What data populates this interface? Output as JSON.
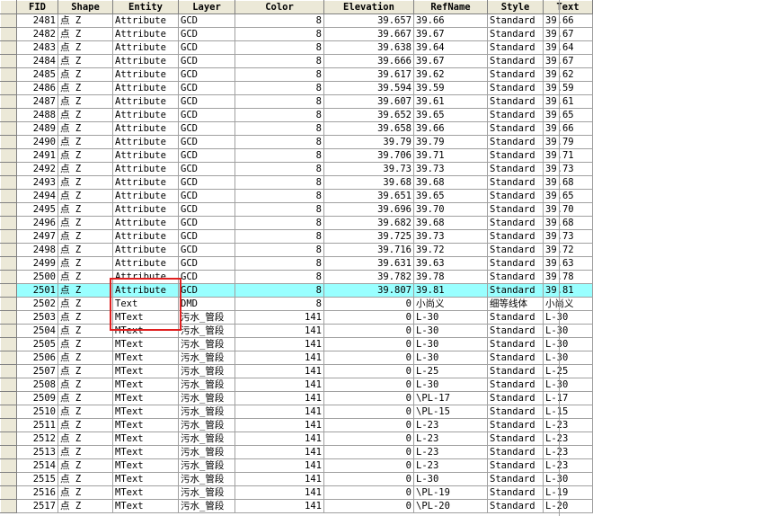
{
  "table": {
    "columns": [
      "FID",
      "Shape",
      "Entity",
      "Layer",
      "Color",
      "Elevation",
      "RefName",
      "Style",
      "Text"
    ],
    "highlighted_fid": "2501",
    "rows": [
      [
        "2481",
        "点 Z",
        "Attribute",
        "GCD",
        "8",
        "39.657",
        "39.66",
        "Standard",
        "39.66"
      ],
      [
        "2482",
        "点 Z",
        "Attribute",
        "GCD",
        "8",
        "39.667",
        "39.67",
        "Standard",
        "39.67"
      ],
      [
        "2483",
        "点 Z",
        "Attribute",
        "GCD",
        "8",
        "39.638",
        "39.64",
        "Standard",
        "39.64"
      ],
      [
        "2484",
        "点 Z",
        "Attribute",
        "GCD",
        "8",
        "39.666",
        "39.67",
        "Standard",
        "39.67"
      ],
      [
        "2485",
        "点 Z",
        "Attribute",
        "GCD",
        "8",
        "39.617",
        "39.62",
        "Standard",
        "39.62"
      ],
      [
        "2486",
        "点 Z",
        "Attribute",
        "GCD",
        "8",
        "39.594",
        "39.59",
        "Standard",
        "39.59"
      ],
      [
        "2487",
        "点 Z",
        "Attribute",
        "GCD",
        "8",
        "39.607",
        "39.61",
        "Standard",
        "39.61"
      ],
      [
        "2488",
        "点 Z",
        "Attribute",
        "GCD",
        "8",
        "39.652",
        "39.65",
        "Standard",
        "39.65"
      ],
      [
        "2489",
        "点 Z",
        "Attribute",
        "GCD",
        "8",
        "39.658",
        "39.66",
        "Standard",
        "39.66"
      ],
      [
        "2490",
        "点 Z",
        "Attribute",
        "GCD",
        "8",
        "39.79",
        "39.79",
        "Standard",
        "39.79"
      ],
      [
        "2491",
        "点 Z",
        "Attribute",
        "GCD",
        "8",
        "39.706",
        "39.71",
        "Standard",
        "39.71"
      ],
      [
        "2492",
        "点 Z",
        "Attribute",
        "GCD",
        "8",
        "39.73",
        "39.73",
        "Standard",
        "39.73"
      ],
      [
        "2493",
        "点 Z",
        "Attribute",
        "GCD",
        "8",
        "39.68",
        "39.68",
        "Standard",
        "39.68"
      ],
      [
        "2494",
        "点 Z",
        "Attribute",
        "GCD",
        "8",
        "39.651",
        "39.65",
        "Standard",
        "39.65"
      ],
      [
        "2495",
        "点 Z",
        "Attribute",
        "GCD",
        "8",
        "39.696",
        "39.70",
        "Standard",
        "39.70"
      ],
      [
        "2496",
        "点 Z",
        "Attribute",
        "GCD",
        "8",
        "39.682",
        "39.68",
        "Standard",
        "39.68"
      ],
      [
        "2497",
        "点 Z",
        "Attribute",
        "GCD",
        "8",
        "39.725",
        "39.73",
        "Standard",
        "39.73"
      ],
      [
        "2498",
        "点 Z",
        "Attribute",
        "GCD",
        "8",
        "39.716",
        "39.72",
        "Standard",
        "39.72"
      ],
      [
        "2499",
        "点 Z",
        "Attribute",
        "GCD",
        "8",
        "39.631",
        "39.63",
        "Standard",
        "39.63"
      ],
      [
        "2500",
        "点 Z",
        "Attribute",
        "GCD",
        "8",
        "39.782",
        "39.78",
        "Standard",
        "39.78"
      ],
      [
        "2501",
        "点 Z",
        "Attribute",
        "GCD",
        "8",
        "39.807",
        "39.81",
        "Standard",
        "39.81"
      ],
      [
        "2502",
        "点 Z",
        "Text",
        "DMD",
        "8",
        "0",
        "小尚义",
        "细等线体",
        "小尚义"
      ],
      [
        "2503",
        "点 Z",
        "MText",
        "污水_管段",
        "141",
        "0",
        " L-30",
        "Standard",
        " L-30"
      ],
      [
        "2504",
        "点 Z",
        "MText",
        "污水_管段",
        "141",
        "0",
        " L-30",
        "Standard",
        " L-30"
      ],
      [
        "2505",
        "点 Z",
        "MText",
        "污水_管段",
        "141",
        "0",
        " L-30",
        "Standard",
        " L-30"
      ],
      [
        "2506",
        "点 Z",
        "MText",
        "污水_管段",
        "141",
        "0",
        " L-30",
        "Standard",
        " L-30"
      ],
      [
        "2507",
        "点 Z",
        "MText",
        "污水_管段",
        "141",
        "0",
        " L-25",
        "Standard",
        " L-25"
      ],
      [
        "2508",
        "点 Z",
        "MText",
        "污水_管段",
        "141",
        "0",
        " L-30",
        "Standard",
        " L-30"
      ],
      [
        "2509",
        "点 Z",
        "MText",
        "污水_管段",
        "141",
        "0",
        "\\PL-17",
        "Standard",
        " L-17"
      ],
      [
        "2510",
        "点 Z",
        "MText",
        "污水_管段",
        "141",
        "0",
        "\\PL-15",
        "Standard",
        " L-15"
      ],
      [
        "2511",
        "点 Z",
        "MText",
        "污水_管段",
        "141",
        "0",
        " L-23",
        "Standard",
        " L-23"
      ],
      [
        "2512",
        "点 Z",
        "MText",
        "污水_管段",
        "141",
        "0",
        " L-23",
        "Standard",
        " L-23"
      ],
      [
        "2513",
        "点 Z",
        "MText",
        "污水_管段",
        "141",
        "0",
        " L-23",
        "Standard",
        " L-23"
      ],
      [
        "2514",
        "点 Z",
        "MText",
        "污水_管段",
        "141",
        "0",
        " L-23",
        "Standard",
        " L-23"
      ],
      [
        "2515",
        "点 Z",
        "MText",
        "污水_管段",
        "141",
        "0",
        " L-30",
        "Standard",
        " L-30"
      ],
      [
        "2516",
        "点 Z",
        "MText",
        "污水_管段",
        "141",
        "0",
        "\\PL-19",
        "Standard",
        " L-19"
      ],
      [
        "2517",
        "点 Z",
        "MText",
        "污水_管段",
        "141",
        "0",
        "\\PL-20",
        "Standard",
        " L-20"
      ]
    ]
  },
  "colors": {
    "highlight_row": "#99ffff",
    "annotation_box": "#e02020",
    "header_bg": "#ece9d8"
  }
}
